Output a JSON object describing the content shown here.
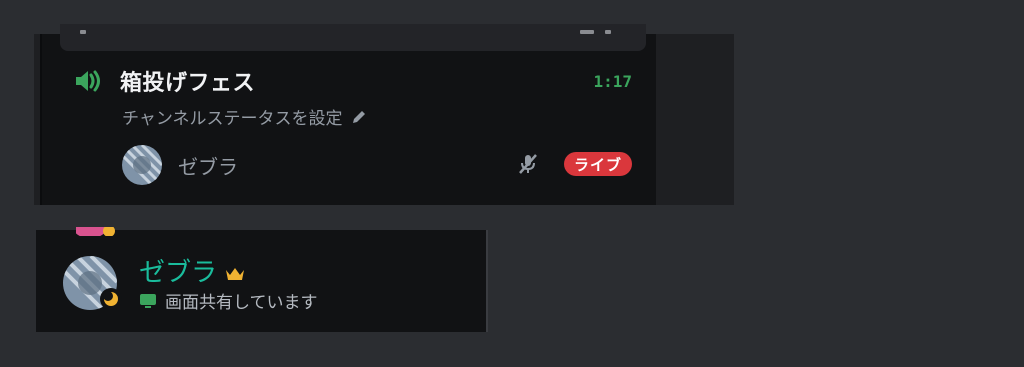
{
  "voice_channel": {
    "name": "箱投げフェス",
    "timer": "1:17",
    "status_placeholder": "チャンネルステータスを設定",
    "participant": {
      "name": "ゼブラ",
      "badge": "ライブ"
    }
  },
  "user_panel": {
    "name": "ゼブラ",
    "activity": "画面共有しています"
  },
  "colors": {
    "background": "#2b2d31",
    "panel": "#111214",
    "voice_green": "#3ba55d",
    "live_red": "#da373c",
    "name_teal": "#1abc9c",
    "crown_gold": "#f0b232",
    "idle_moon": "#f0b232"
  },
  "icons": {
    "voice": "speaker-connected-icon",
    "status_edit": "pencil-icon",
    "mute": "muted-microphone-icon",
    "crown": "crown-icon",
    "screen_share": "screen-share-icon",
    "idle": "moon-icon"
  }
}
